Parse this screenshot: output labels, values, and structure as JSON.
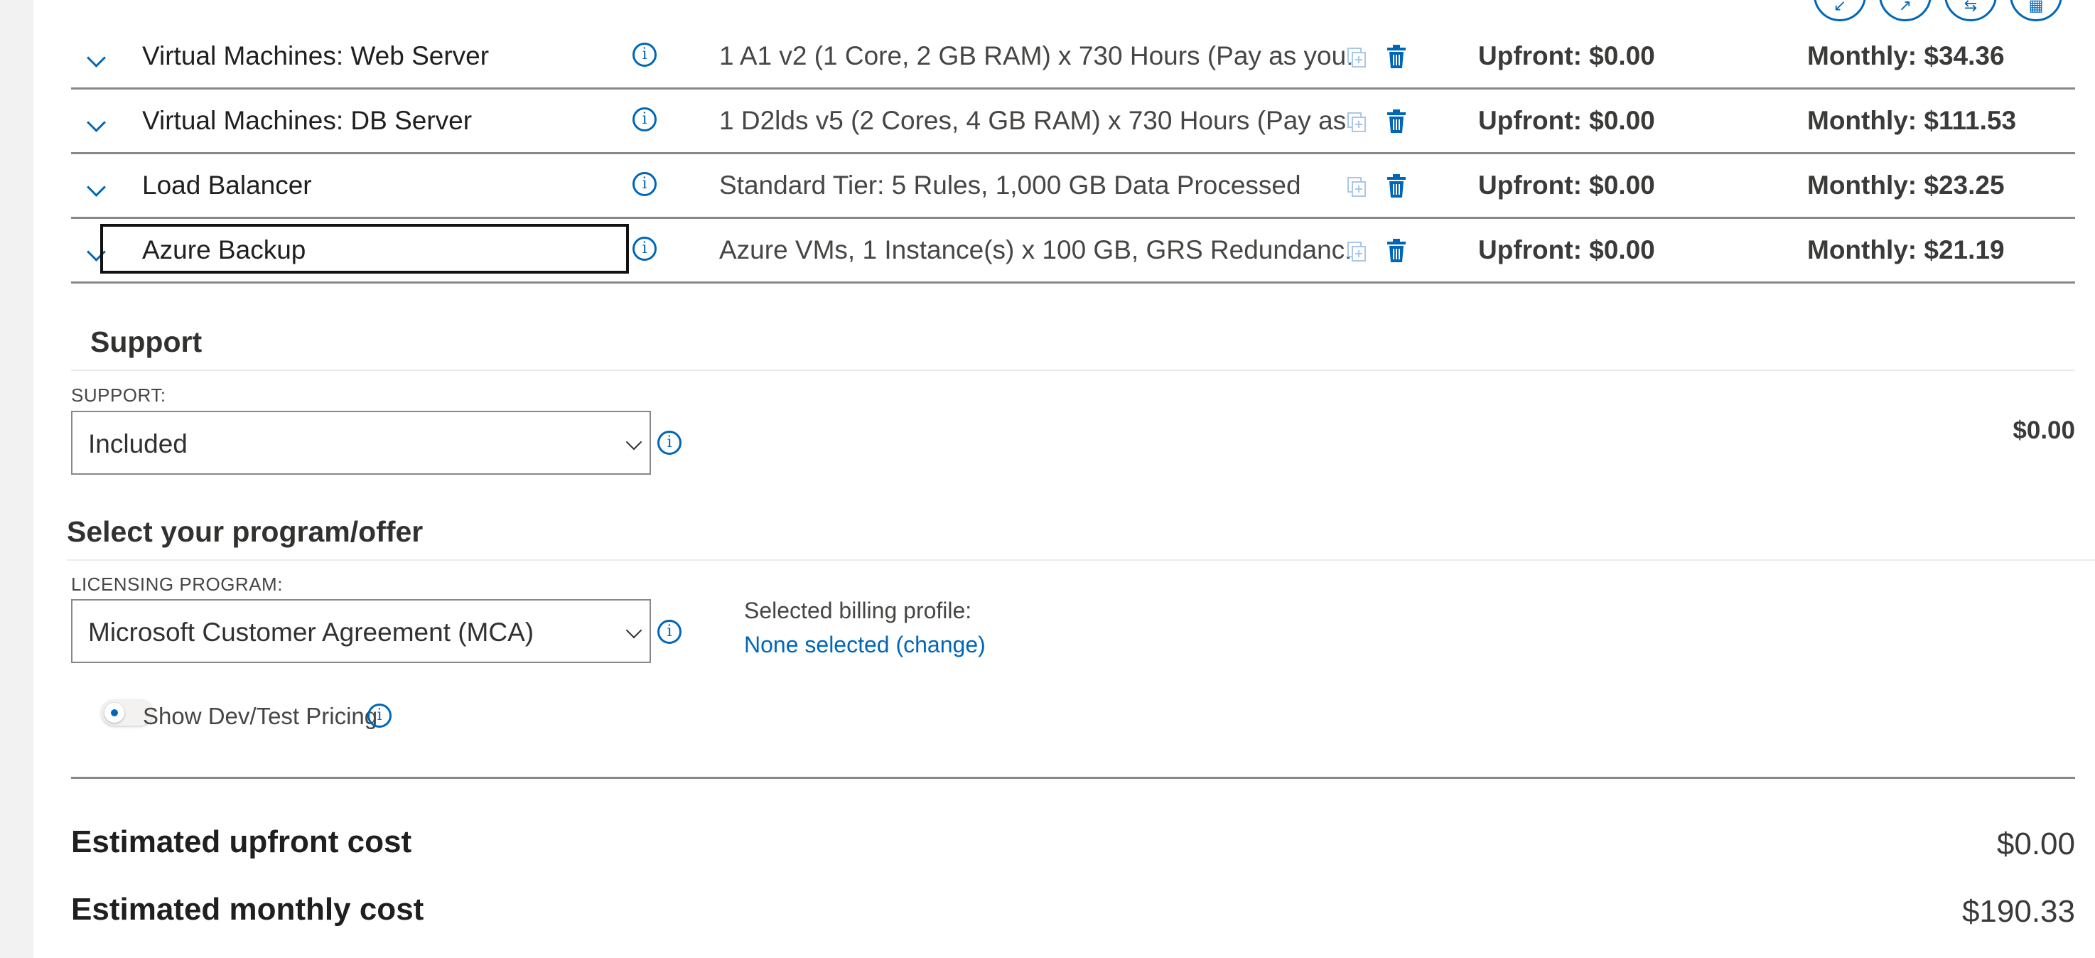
{
  "header": {
    "icons": [
      "collapse-icon",
      "expand-icon",
      "share-icon",
      "export-icon"
    ]
  },
  "services": [
    {
      "name": "Virtual Machines: Web Server",
      "description": "1 A1 v2 (1 Core, 2 GB RAM) x 730 Hours (Pay as you...",
      "upfront": "Upfront: $0.00",
      "monthly": "Monthly: $34.36"
    },
    {
      "name": "Virtual Machines: DB Server",
      "description": "1 D2lds v5 (2 Cores, 4 GB RAM) x 730 Hours (Pay as ...",
      "upfront": "Upfront: $0.00",
      "monthly": "Monthly: $111.53"
    },
    {
      "name": "Load Balancer",
      "description": "Standard Tier: 5 Rules, 1,000 GB Data Processed",
      "upfront": "Upfront: $0.00",
      "monthly": "Monthly: $23.25"
    },
    {
      "name": "Azure Backup",
      "description": "Azure VMs, 1 Instance(s) x 100 GB, GRS Redundanc...",
      "upfront": "Upfront: $0.00",
      "monthly": "Monthly: $21.19"
    }
  ],
  "support": {
    "title": "Support",
    "label": "SUPPORT:",
    "selected": "Included",
    "price": "$0.00"
  },
  "program": {
    "title": "Select your program/offer",
    "label": "LICENSING PROGRAM:",
    "selected": "Microsoft Customer Agreement (MCA)",
    "billing_label": "Selected billing profile:",
    "billing_link": "None selected (change)"
  },
  "devtest": {
    "label": "Show Dev/Test Pricing",
    "enabled": false
  },
  "totals": {
    "upfront_label": "Estimated upfront cost",
    "upfront_value": "$0.00",
    "monthly_label": "Estimated monthly cost",
    "monthly_value": "$190.33"
  },
  "colors": {
    "accent": "#0067b8",
    "separator": "#8a8886"
  }
}
